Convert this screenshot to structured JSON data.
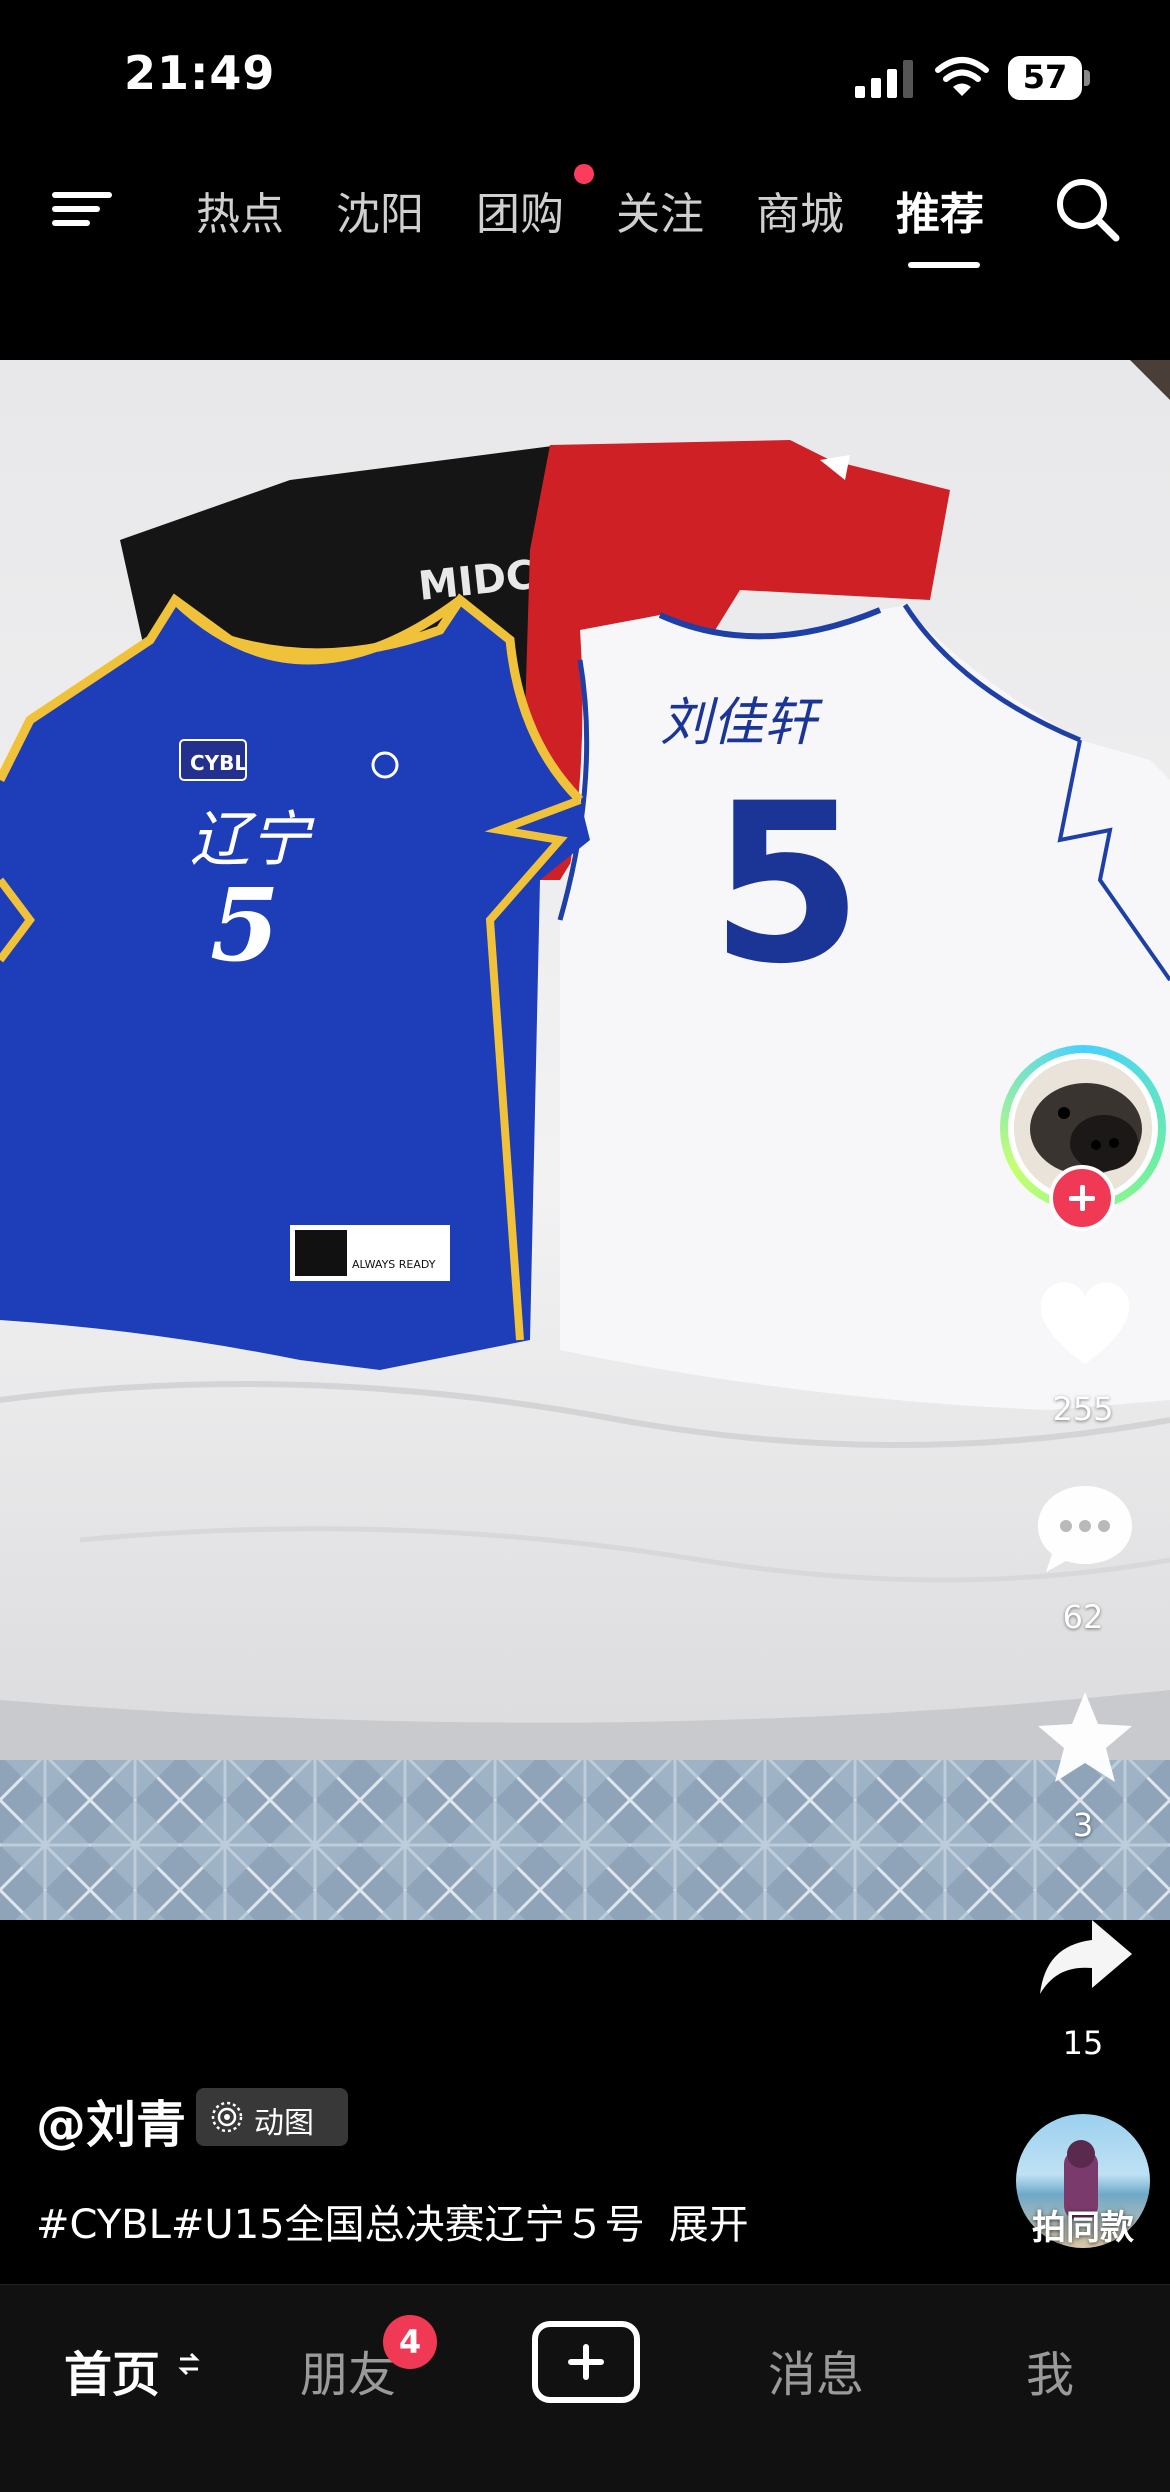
{
  "status_bar": {
    "time": "21:49",
    "battery": "57"
  },
  "top_nav": {
    "tabs": [
      {
        "label": "热点"
      },
      {
        "label": "沈阳"
      },
      {
        "label": "团购"
      },
      {
        "label": "关注"
      },
      {
        "label": "商城"
      },
      {
        "label": "推荐"
      }
    ],
    "active_tab": "推荐"
  },
  "photo": {
    "blue_jersey_text": "辽宁",
    "blue_jersey_number": "5",
    "blue_jersey_logo": "CYBL",
    "white_jersey_name": "刘佳轩",
    "white_jersey_number": "5",
    "black_shirt_print": "MIDCOURT",
    "tag_text": "ALWAYS READY"
  },
  "rail": {
    "likes": "255",
    "comments": "62",
    "favorites": "3",
    "shares": "15"
  },
  "post": {
    "author": "@刘青",
    "badge": "动图",
    "caption": "#CYBL#U15全国总决赛辽宁５号",
    "expand": "展开",
    "same_style": "拍同款"
  },
  "tabbar": {
    "home": "首页",
    "friends": "朋友",
    "friends_badge": "4",
    "messages": "消息",
    "me": "我"
  },
  "colors": {
    "accent_red": "#f03a55",
    "blue_jersey": "#1a3fbf",
    "red_shirt": "#d3232a"
  }
}
